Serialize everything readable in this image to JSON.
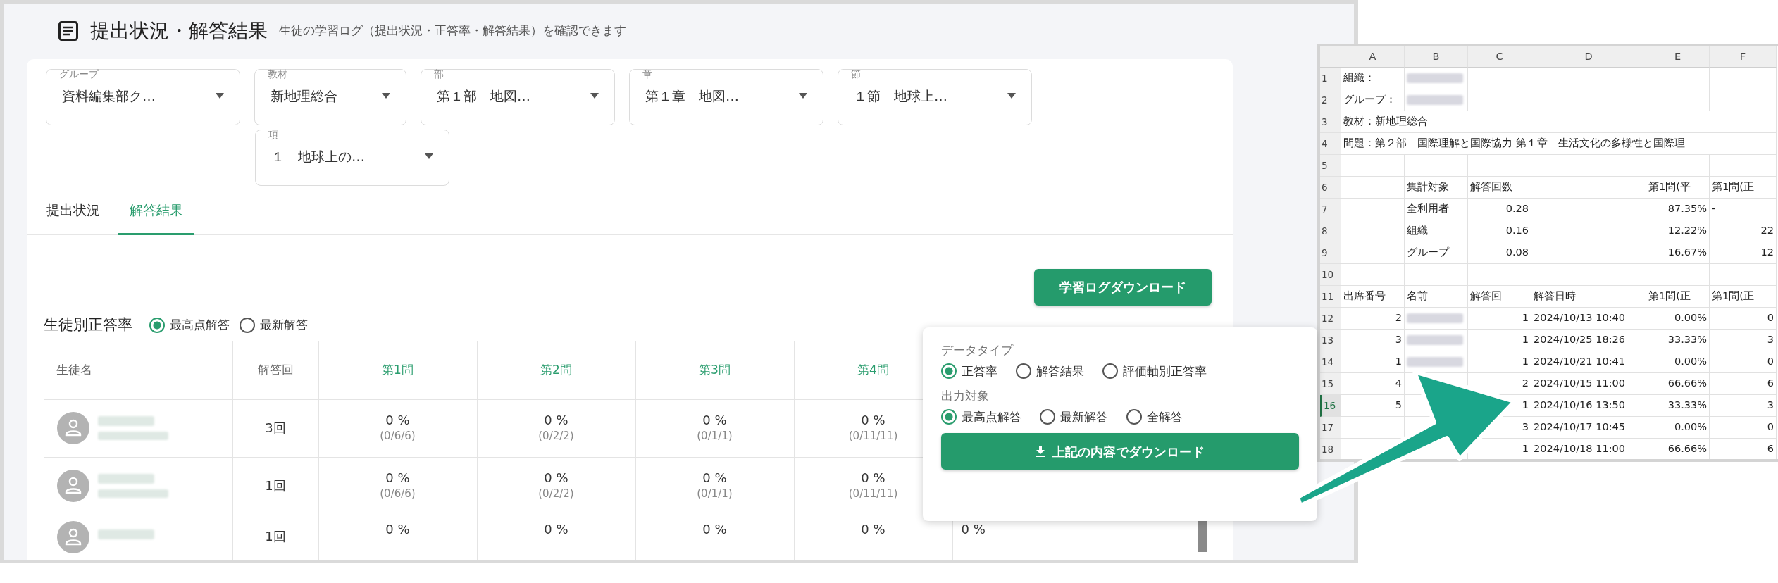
{
  "header": {
    "title": "提出状況・解答結果",
    "subtitle": "生徒の学習ログ（提出状況・正答率・解答結果）を確認できます"
  },
  "filters": [
    {
      "label": "グループ",
      "value": "資料編集部ク…"
    },
    {
      "label": "教材",
      "value": "新地理総合"
    },
    {
      "label": "部",
      "value": "第１部　地図…"
    },
    {
      "label": "章",
      "value": "第１章　地図…"
    },
    {
      "label": "節",
      "value": "１節　地球上…"
    },
    {
      "label": "項",
      "value": "１　地球上の…"
    }
  ],
  "tabs": [
    {
      "label": "提出状況",
      "selected": false
    },
    {
      "label": "解答結果",
      "selected": true
    }
  ],
  "download_button": "学習ログダウンロード",
  "section": {
    "title": "生徒別正答率",
    "options": [
      {
        "label": "最高点解答",
        "selected": true
      },
      {
        "label": "最新解答",
        "selected": false
      }
    ]
  },
  "table": {
    "columns": [
      "生徒名",
      "解答回",
      "第1問",
      "第2問",
      "第3問",
      "第4問"
    ],
    "rows": [
      {
        "attempts": "3回",
        "answers": [
          {
            "rate": "0 %",
            "detail": "(0/6/6)"
          },
          {
            "rate": "0 %",
            "detail": "(0/2/2)"
          },
          {
            "rate": "0 %",
            "detail": "(0/1/1)"
          },
          {
            "rate": "0 %",
            "detail": "(0/11/11)"
          }
        ]
      },
      {
        "attempts": "1回",
        "answers": [
          {
            "rate": "0 %",
            "detail": "(0/6/6)"
          },
          {
            "rate": "0 %",
            "detail": "(0/2/2)"
          },
          {
            "rate": "0 %",
            "detail": "(0/1/1)"
          },
          {
            "rate": "0 %",
            "detail": "(0/11/11)"
          }
        ]
      },
      {
        "attempts": "1回",
        "answers": [
          {
            "rate": "0 %"
          },
          {
            "rate": "0 %"
          },
          {
            "rate": "0 %"
          },
          {
            "rate": "0 %"
          },
          {
            "rate": "0 %"
          }
        ]
      }
    ]
  },
  "popup": {
    "groups": [
      {
        "label": "データタイプ",
        "options": [
          {
            "label": "正答率",
            "selected": true
          },
          {
            "label": "解答結果",
            "selected": false
          },
          {
            "label": "評価軸別正答率",
            "selected": false
          }
        ]
      },
      {
        "label": "出力対象",
        "options": [
          {
            "label": "最高点解答",
            "selected": true
          },
          {
            "label": "最新解答",
            "selected": false
          },
          {
            "label": "全解答",
            "selected": false
          }
        ]
      }
    ],
    "button": "上記の内容でダウンロード"
  },
  "spreadsheet": {
    "columns": [
      "A",
      "B",
      "C",
      "D",
      "E",
      "F"
    ],
    "rows": [
      {
        "number": "1",
        "selected": false,
        "cells": {
          "A": {
            "kind": "text",
            "text": "組織："
          },
          "B": {
            "kind": "redacted"
          }
        }
      },
      {
        "number": "2",
        "selected": false,
        "cells": {
          "A": {
            "kind": "text",
            "text": "グループ："
          },
          "B": {
            "kind": "redacted"
          }
        }
      },
      {
        "number": "3",
        "selected": false,
        "cells": {
          "A": {
            "kind": "text",
            "text": "教材：新地理総合"
          }
        }
      },
      {
        "number": "4",
        "selected": false,
        "cells": {
          "A": {
            "kind": "text",
            "text": "問題：第２部　国際理解と国際協力 第１章　生活文化の多様性と国際理"
          }
        }
      },
      {
        "number": "5",
        "selected": false
      },
      {
        "number": "6",
        "selected": false,
        "cells": {
          "B": {
            "kind": "text",
            "text": "集計対象"
          },
          "C": {
            "kind": "text",
            "text": "解答回数"
          },
          "E": {
            "kind": "text",
            "text": "第1問(平"
          },
          "F": {
            "kind": "text",
            "text": "第1問(正"
          }
        }
      },
      {
        "number": "7",
        "selected": false,
        "cells": {
          "B": {
            "kind": "text",
            "text": "全利用者"
          },
          "C": {
            "kind": "number",
            "text": "0.28"
          },
          "E": {
            "kind": "number",
            "text": "87.35%"
          },
          "F": {
            "kind": "text",
            "text": "-"
          }
        }
      },
      {
        "number": "8",
        "selected": false,
        "cells": {
          "B": {
            "kind": "text",
            "text": "組織"
          },
          "C": {
            "kind": "number",
            "text": "0.16"
          },
          "E": {
            "kind": "number",
            "text": "12.22%"
          },
          "F": {
            "kind": "number",
            "text": "22"
          }
        }
      },
      {
        "number": "9",
        "selected": false,
        "cells": {
          "B": {
            "kind": "text",
            "text": "グループ"
          },
          "C": {
            "kind": "number",
            "text": "0.08"
          },
          "E": {
            "kind": "number",
            "text": "16.67%"
          },
          "F": {
            "kind": "number",
            "text": "12"
          }
        }
      },
      {
        "number": "10",
        "selected": false
      },
      {
        "number": "11",
        "selected": false,
        "cells": {
          "A": {
            "kind": "text",
            "text": "出席番号"
          },
          "B": {
            "kind": "text",
            "text": "名前"
          },
          "C": {
            "kind": "text",
            "text": "解答回"
          },
          "D": {
            "kind": "text",
            "text": "解答日時"
          },
          "E": {
            "kind": "text",
            "text": "第1問(正"
          },
          "F": {
            "kind": "text",
            "text": "第1問(正"
          }
        }
      },
      {
        "number": "12",
        "selected": false,
        "cells": {
          "A": {
            "kind": "number",
            "text": "2"
          },
          "B": {
            "kind": "redacted"
          },
          "C": {
            "kind": "number",
            "text": "1"
          },
          "D": {
            "kind": "text",
            "text": "2024/10/13 10:40"
          },
          "E": {
            "kind": "number",
            "text": "0.00%"
          },
          "F": {
            "kind": "number",
            "text": "0"
          }
        }
      },
      {
        "number": "13",
        "selected": false,
        "cells": {
          "A": {
            "kind": "number",
            "text": "3"
          },
          "B": {
            "kind": "redacted"
          },
          "C": {
            "kind": "number",
            "text": "1"
          },
          "D": {
            "kind": "text",
            "text": "2024/10/25 18:26"
          },
          "E": {
            "kind": "number",
            "text": "33.33%"
          },
          "F": {
            "kind": "number",
            "text": "3"
          }
        }
      },
      {
        "number": "14",
        "selected": false,
        "cells": {
          "A": {
            "kind": "number",
            "text": "1"
          },
          "B": {
            "kind": "redacted"
          },
          "C": {
            "kind": "number",
            "text": "1"
          },
          "D": {
            "kind": "text",
            "text": "2024/10/21 10:41"
          },
          "E": {
            "kind": "number",
            "text": "0.00%"
          },
          "F": {
            "kind": "number",
            "text": "0"
          }
        }
      },
      {
        "number": "15",
        "selected": false,
        "cells": {
          "A": {
            "kind": "number",
            "text": "4"
          },
          "C": {
            "kind": "number",
            "text": "2"
          },
          "D": {
            "kind": "text",
            "text": "2024/10/15 11:00"
          },
          "E": {
            "kind": "number",
            "text": "66.66%"
          },
          "F": {
            "kind": "number",
            "text": "6"
          }
        }
      },
      {
        "number": "16",
        "selected": true,
        "cells": {
          "A": {
            "kind": "number",
            "text": "5"
          },
          "C": {
            "kind": "number",
            "text": "1"
          },
          "D": {
            "kind": "text",
            "text": "2024/10/16 13:50"
          },
          "E": {
            "kind": "number",
            "text": "33.33%"
          },
          "F": {
            "kind": "number",
            "text": "3"
          }
        }
      },
      {
        "number": "17",
        "selected": false,
        "cells": {
          "C": {
            "kind": "number",
            "text": "3"
          },
          "D": {
            "kind": "text",
            "text": "2024/10/17 10:45"
          },
          "E": {
            "kind": "number",
            "text": "0.00%"
          },
          "F": {
            "kind": "number",
            "text": "0"
          }
        }
      },
      {
        "number": "18",
        "selected": false,
        "cells": {
          "C": {
            "kind": "number",
            "text": "1"
          },
          "D": {
            "kind": "text",
            "text": "2024/10/18 11:00"
          },
          "E": {
            "kind": "number",
            "text": "66.66%"
          },
          "F": {
            "kind": "number",
            "text": "6"
          }
        }
      }
    ]
  }
}
